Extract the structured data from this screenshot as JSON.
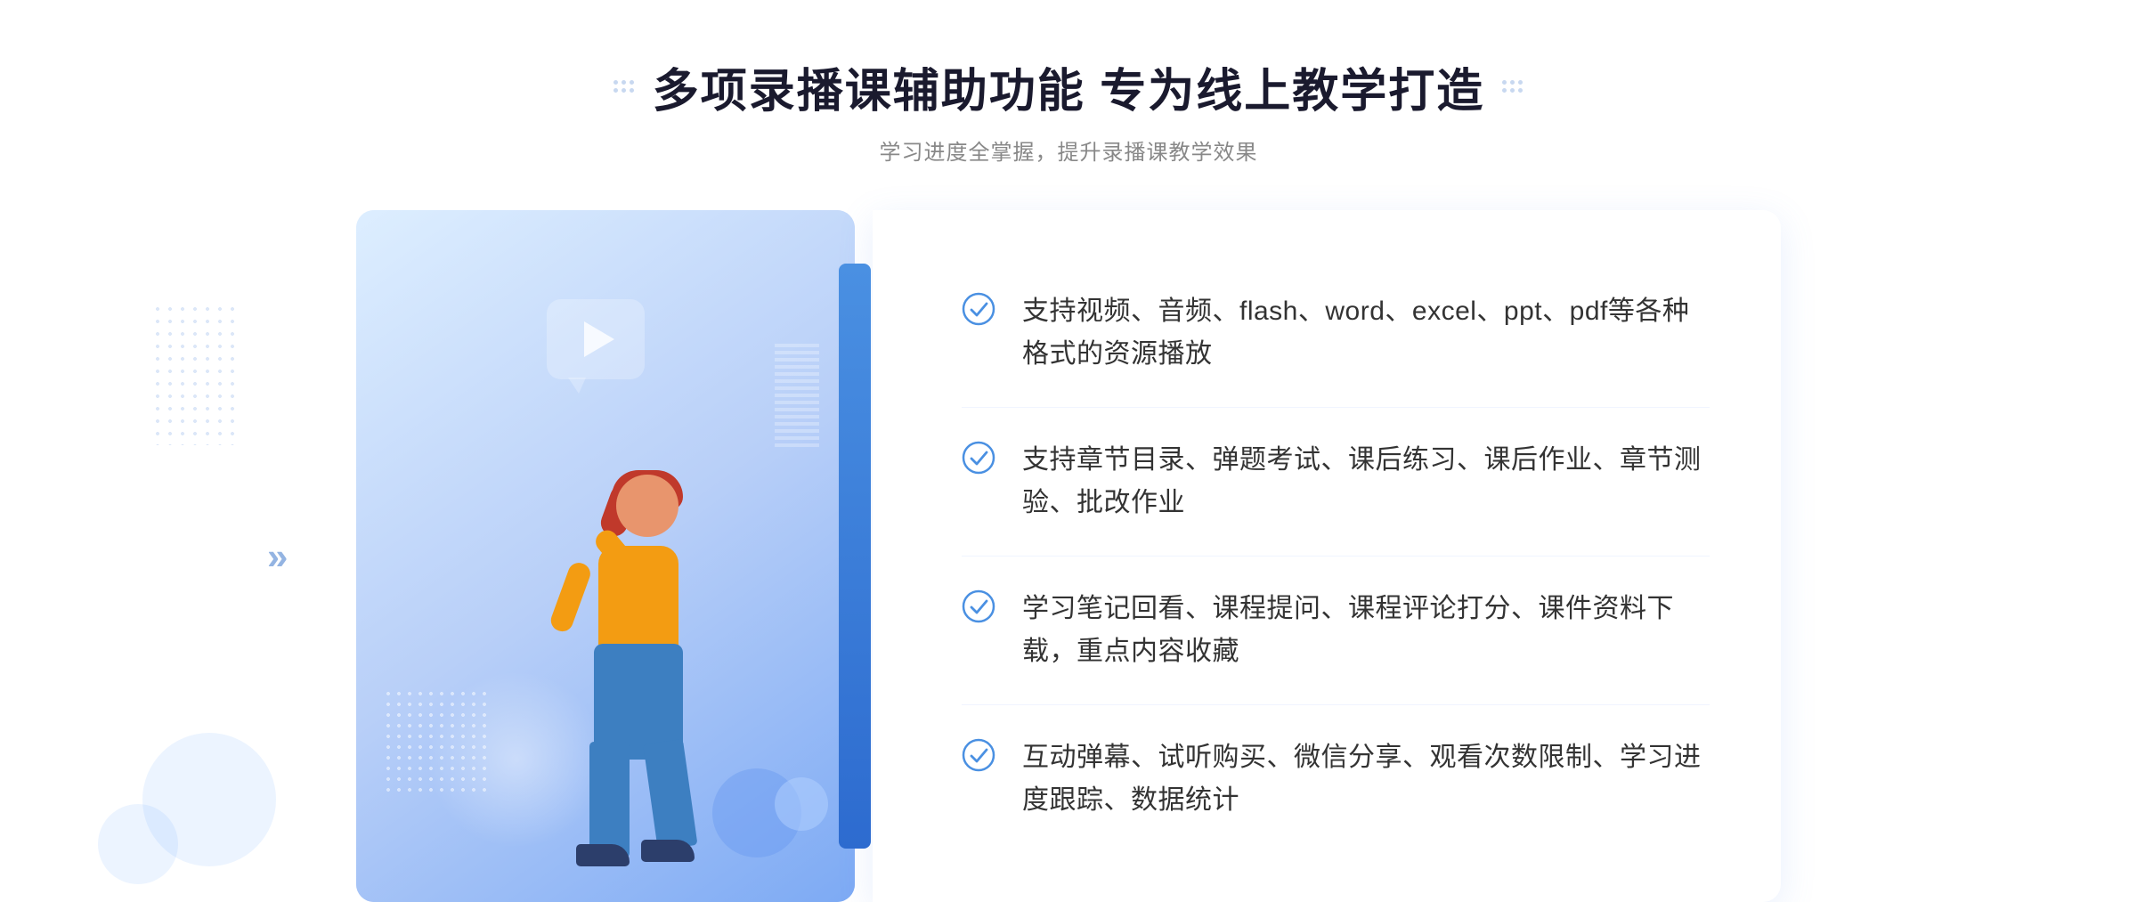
{
  "header": {
    "title": "多项录播课辅助功能 专为线上教学打造",
    "subtitle": "学习进度全掌握，提升录播课教学效果"
  },
  "features": [
    {
      "id": "feature-1",
      "text": "支持视频、音频、flash、word、excel、ppt、pdf等各种格式的资源播放"
    },
    {
      "id": "feature-2",
      "text": "支持章节目录、弹题考试、课后练习、课后作业、章节测验、批改作业"
    },
    {
      "id": "feature-3",
      "text": "学习笔记回看、课程提问、课程评论打分、课件资料下载，重点内容收藏"
    },
    {
      "id": "feature-4",
      "text": "互动弹幕、试听购买、微信分享、观看次数限制、学习进度跟踪、数据统计"
    }
  ],
  "decorations": {
    "chevron": "»",
    "check_color": "#4a90e2",
    "title_dot_color": "#c8d8f0"
  }
}
